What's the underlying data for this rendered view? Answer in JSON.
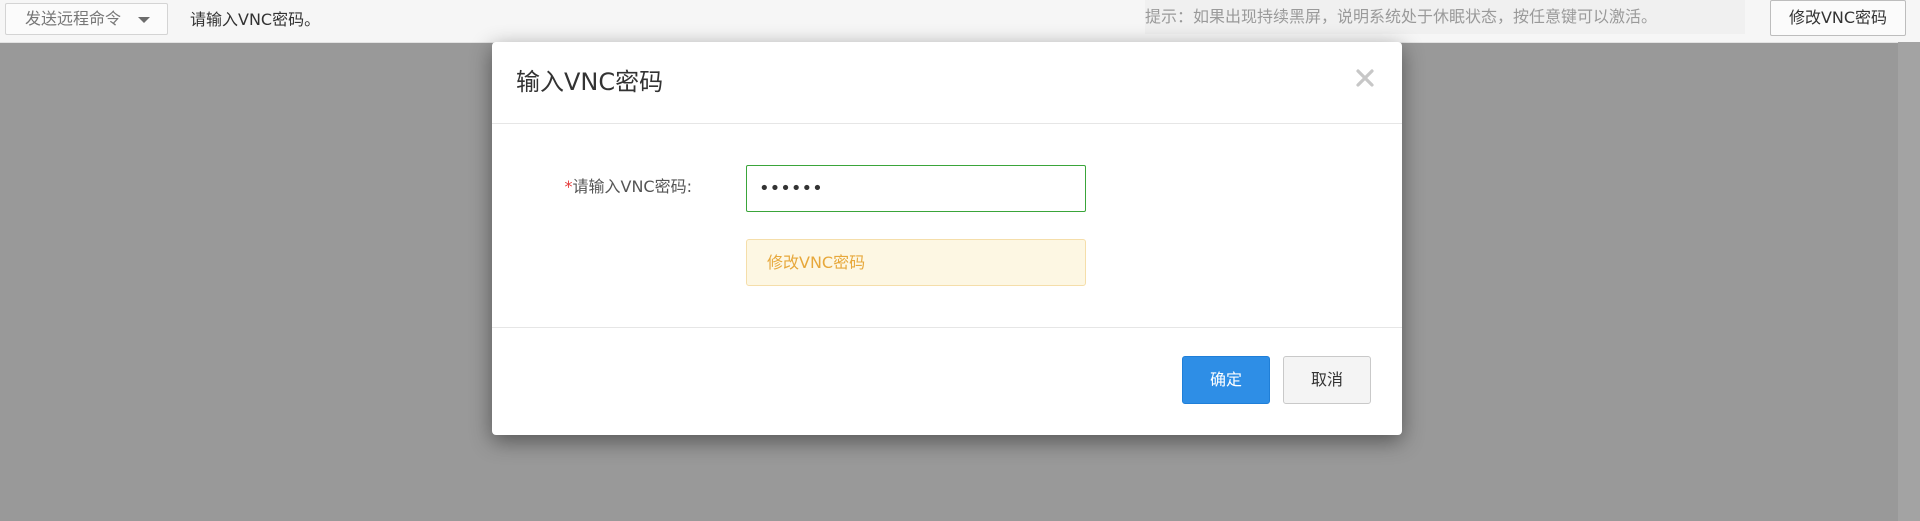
{
  "toolbar": {
    "send_command_label": "发送远程命令",
    "status_text": "请输入VNC密码。",
    "tip_text": "提示：如果出现持续黑屏，说明系统处于休眠状态，按任意键可以激活。",
    "change_password_label": "修改VNC密码"
  },
  "modal": {
    "title": "输入VNC密码",
    "field": {
      "required_mark": "*",
      "label": "请输入VNC密码:",
      "value": "••••••"
    },
    "change_password_link": "修改VNC密码",
    "confirm_label": "确定",
    "cancel_label": "取消"
  },
  "icons": {
    "close": "close-icon",
    "caret": "chevron-down-icon"
  },
  "colors": {
    "overlay": "#999999",
    "primary": "#2e8ee6",
    "input_border": "#3aa53a",
    "warning_text": "#e7a83b",
    "warning_bg": "#fdf7e3",
    "required": "#e43a3a"
  }
}
